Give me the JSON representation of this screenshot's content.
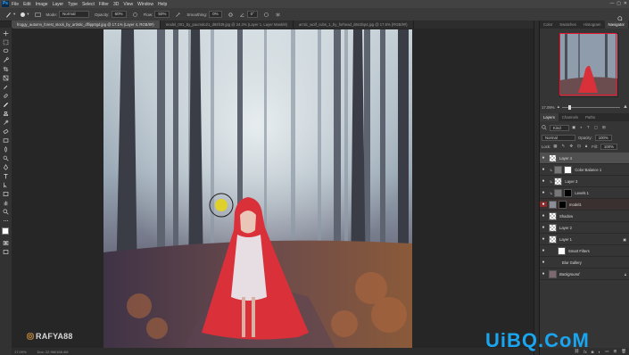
{
  "menu": {
    "logo": "Ps",
    "items": [
      "File",
      "Edit",
      "Image",
      "Layer",
      "Type",
      "Select",
      "Filter",
      "3D",
      "View",
      "Window",
      "Help"
    ]
  },
  "options": {
    "mode_label": "Mode:",
    "mode_value": "Normal",
    "opacity_label": "Opacity:",
    "opacity_value": "60%",
    "flow_label": "Flow:",
    "flow_value": "50%",
    "smoothing_label": "Smoothing:",
    "smoothing_value": "0%",
    "angle_value": "0°"
  },
  "tabs": [
    {
      "label": "froggy_autumn_forest_stock_by_artistic_dflipp0gd.jpg @ 17.1% (Layer 4, RGB/8#)",
      "active": true
    },
    {
      "label": "model_001_by_paumdo21_d84fct9.jpg @ 24.3% (Layer 1, Layer Mask/8)",
      "active": false
    },
    {
      "label": "arctic_wolf_cubs_1_by_forhead_d6n3bp4.jpg @ 17.5% (RGB/8#)",
      "active": false
    }
  ],
  "status": {
    "zoom": "17.09%",
    "doc": "Doc: 22.9M/168.4M"
  },
  "watermark": "RAFYA88",
  "brand": "UiBQ.CoM",
  "panels": {
    "top_tabs": [
      "Color",
      "Swatches",
      "Histogram",
      "Navigator"
    ],
    "active_top": "Navigator",
    "nav_zoom": "17.09%",
    "layer_tabs": [
      "Layers",
      "Channels",
      "Paths"
    ],
    "kind_label": "Kind",
    "blend_mode": "Normal",
    "opacity_label": "Opacity:",
    "opacity_value": "100%",
    "lock_label": "Lock:",
    "fill_label": "Fill:",
    "fill_value": "100%"
  },
  "layers": [
    {
      "name": "Layer 4",
      "type": "checker",
      "mask": false,
      "selected": true,
      "indent": false
    },
    {
      "name": "Color Balance 1",
      "type": "adjust",
      "mask": true,
      "selected": false,
      "indent": true
    },
    {
      "name": "Layer 3",
      "type": "checker",
      "mask": false,
      "selected": false,
      "indent": true
    },
    {
      "name": "Levels 1",
      "type": "adjust",
      "mask": true,
      "selected": false,
      "indent": true
    },
    {
      "name": "model1",
      "type": "photo",
      "mask": true,
      "selected": false,
      "indent": false
    },
    {
      "name": "Shadow",
      "type": "checker",
      "mask": false,
      "selected": false,
      "indent": false
    },
    {
      "name": "Layer 2",
      "type": "checker",
      "mask": false,
      "selected": false,
      "indent": false
    },
    {
      "name": "Layer 1",
      "type": "checker",
      "mask": false,
      "selected": false,
      "indent": false
    },
    {
      "name": "Smart Filters",
      "type": "white",
      "mask": false,
      "selected": false,
      "indent": true
    },
    {
      "name": "Blur Gallery",
      "type": "none",
      "mask": false,
      "selected": false,
      "indent": true
    },
    {
      "name": "Background",
      "type": "photo",
      "mask": false,
      "selected": false,
      "indent": false
    }
  ],
  "colors": {
    "accent": "#31a8ff",
    "brand": "#1aa5f0",
    "cloak": "#d9303a",
    "nav_frame": "#e8142c"
  }
}
